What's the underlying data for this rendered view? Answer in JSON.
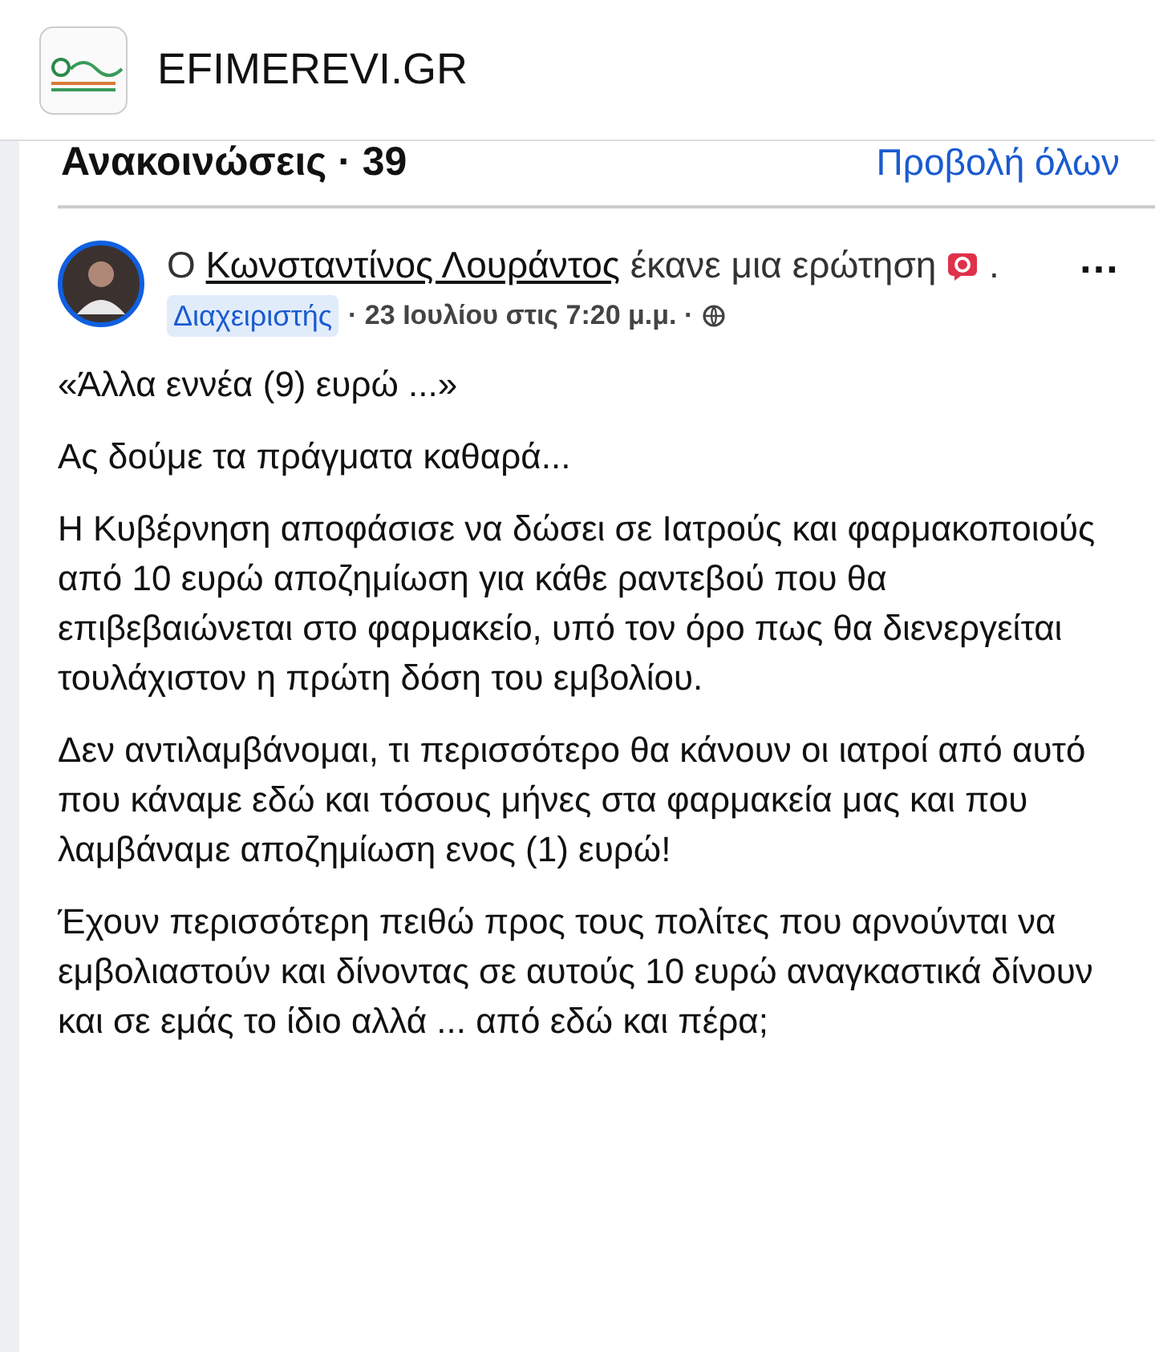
{
  "site": {
    "title": "EFIMEREVI.GR"
  },
  "section": {
    "title": "Ανακοινώσεις · 39",
    "link": "Προβολή όλων"
  },
  "post": {
    "prefix": "Ο",
    "author": "Κωνσταντίνος Λουράντος",
    "action": "έκανε μια ερώτηση",
    "end": ".",
    "badge": "Διαχειριστής",
    "date": "· 23 Ιουλίου στις 7:20 μ.μ. ·",
    "menu": "…",
    "paragraphs": [
      "«Άλλα εννέα (9) ευρώ ...»",
      "Ας δούμε τα πράγματα καθαρά...",
      "Η Κυβέρνηση αποφάσισε να δώσει σε Ιατρούς και φαρμακοποιούς από 10 ευρώ αποζημίωση για κάθε ραντεβού που θα επιβεβαιώνεται στο φαρμακείο, υπό τον όρο πως θα διενεργείται τουλάχιστον η πρώτη δόση του εμβολίου.",
      "Δεν αντιλαμβάνομαι, τι περισσότερο θα κάνουν οι ιατροί από αυτό που κάναμε εδώ και τόσους μήνες στα φαρμακεία μας και που λαμβάναμε αποζημίωση ενος (1) ευρώ!",
      "Έχουν περισσότερη πειθώ προς τους πολίτες που αρνούνται να εμβολιαστούν και δίνοντας σε αυτούς 10 ευρώ αναγκαστικά δίνουν και σε εμάς το ίδιο αλλά ... από εδώ και πέρα;"
    ]
  }
}
